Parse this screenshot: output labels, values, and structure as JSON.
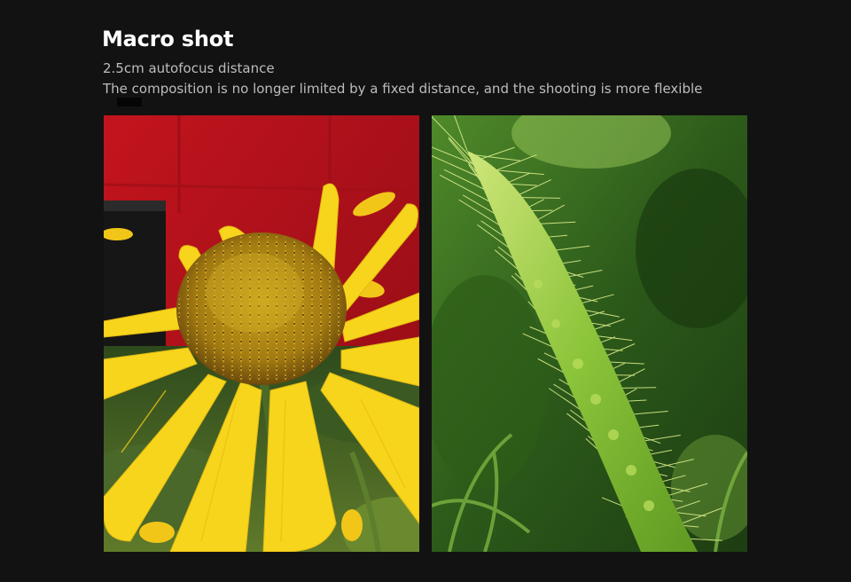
{
  "feature": {
    "title": "Macro shot",
    "subtitle": "2.5cm autofocus distance",
    "description": "The composition is no longer limited by a fixed distance, and the shooting is more flexible"
  },
  "photos": [
    {
      "subject": "yellow daisy flower close-up",
      "icon": "flower-photo"
    },
    {
      "subject": "green foxtail grass close-up",
      "icon": "grass-photo"
    }
  ],
  "colors": {
    "background": "#121212",
    "title": "#ffffff",
    "body_text": "#bdbdbd",
    "petal": "#f5d21a",
    "wall": "#b5121b",
    "foliage": "#3f7a22"
  }
}
